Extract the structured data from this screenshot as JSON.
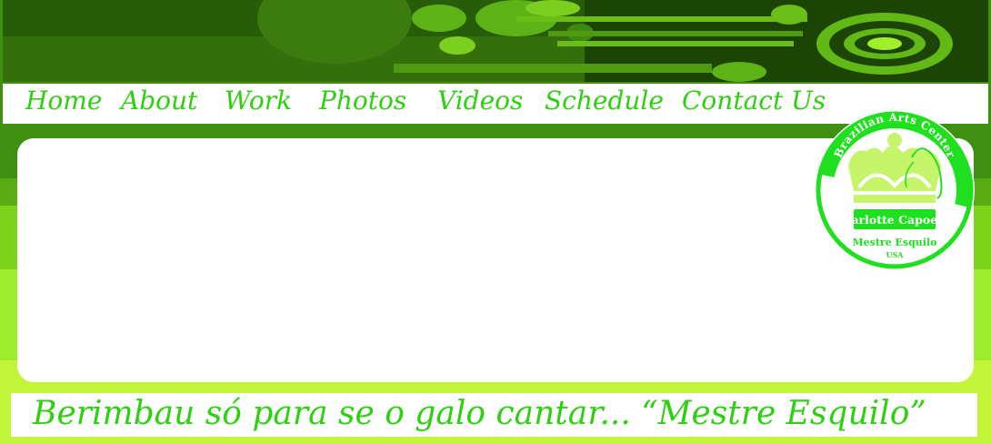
{
  "nav": {
    "items": [
      {
        "label": "Home"
      },
      {
        "label": "About"
      },
      {
        "label": "Work"
      },
      {
        "label": "Photos"
      },
      {
        "label": "Videos"
      },
      {
        "label": "Schedule"
      },
      {
        "label": "Contact Us"
      }
    ]
  },
  "logo": {
    "top_text": "Brazilian Arts Center",
    "name": "Charlotte Capoeira",
    "master": "Mestre Esquilo",
    "country": "USA"
  },
  "quote": {
    "text": "Berimbau só para se o galo cantar... “Mestre Esquilo”"
  },
  "colors": {
    "accent": "#2fd012",
    "dark_green": "#1c4404",
    "lime": "#9ff02a"
  }
}
